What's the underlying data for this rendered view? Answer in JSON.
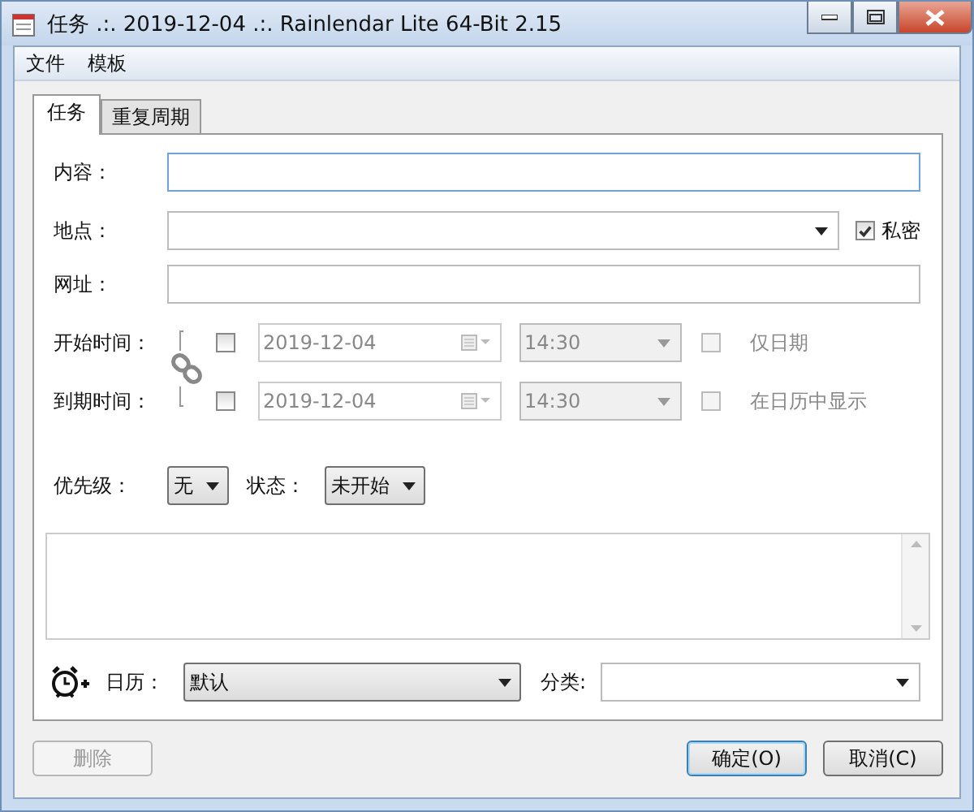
{
  "window": {
    "title": "任务 .:. 2019-12-04 .:. Rainlendar Lite 64-Bit 2.15"
  },
  "menu": [
    "文件",
    "模板"
  ],
  "tabs": [
    {
      "label": "任务",
      "selected": true
    },
    {
      "label": "重复周期",
      "selected": false
    }
  ],
  "content": {
    "label": "内容："
  },
  "location": {
    "label": "地点：",
    "private": {
      "label": "私密",
      "checked": true
    }
  },
  "url": {
    "label": "网址："
  },
  "start": {
    "label": "开始时间：",
    "checked": false,
    "date": "2019-12-04",
    "time": "14:30",
    "disabled": true,
    "option": {
      "label": "仅日期",
      "checked": false
    }
  },
  "due": {
    "label": "到期时间：",
    "checked": false,
    "date": "2019-12-04",
    "time": "14:30",
    "disabled": true,
    "option": {
      "label": "在日历中显示",
      "checked": false
    }
  },
  "priority": {
    "label": "优先级：",
    "value": "无"
  },
  "status": {
    "label": "状态：",
    "value": "未开始"
  },
  "calendar": {
    "label": "日历：",
    "value": "默认"
  },
  "category": {
    "label": "分类:"
  },
  "buttons": [
    {
      "label": "删除",
      "disabled": true,
      "default": false
    },
    {
      "label": "确定(O)",
      "disabled": false,
      "default": true
    },
    {
      "label": "取消(C)",
      "disabled": false,
      "default": false
    }
  ]
}
